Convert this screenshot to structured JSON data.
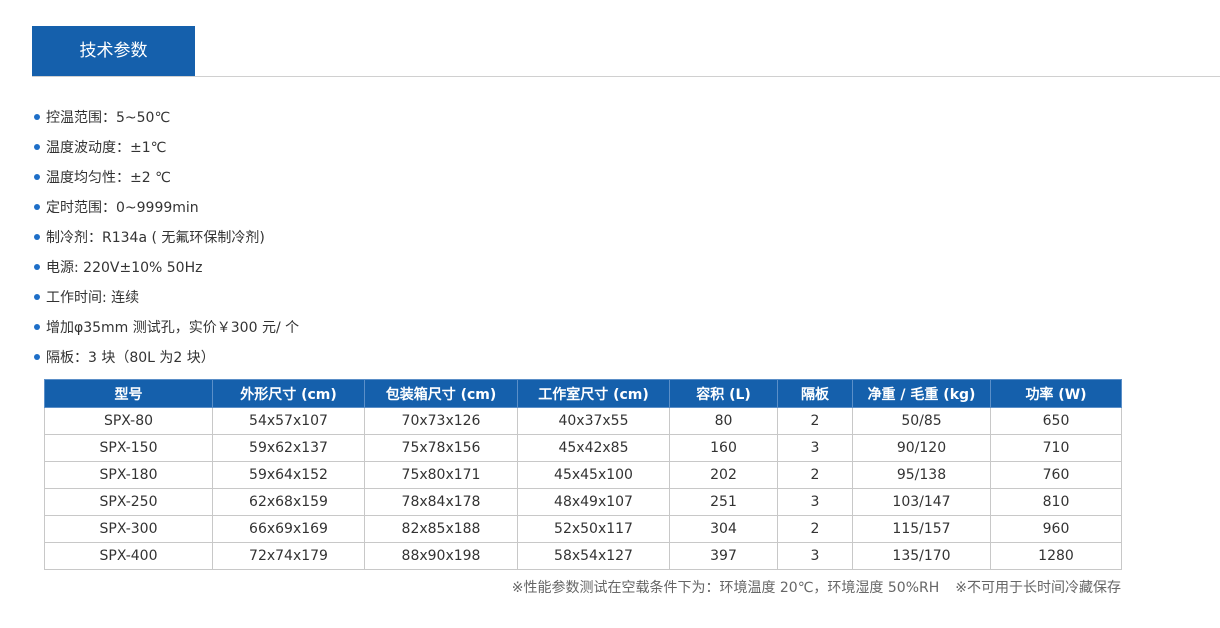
{
  "section": {
    "tab_label": "技术参数",
    "accent_color": "#1560ac",
    "bullet_color": "#1e6fc8"
  },
  "specs": [
    "控温范围：5~50℃",
    "温度波动度：±1℃",
    "温度均匀性：±2 ℃",
    "定时范围：0~9999min",
    "制冷剂：R134a ( 无氟环保制冷剂)",
    "电源: 220V±10% 50Hz",
    "工作时间: 连续",
    "增加φ35mm 测试孔，实价￥300 元/ 个",
    "隔板：3 块（80L 为2 块）"
  ],
  "table": {
    "headers": [
      "型号",
      "外形尺寸 (cm)",
      "包装箱尺寸 (cm)",
      "工作室尺寸 (cm)",
      "容积 (L)",
      "隔板",
      "净重 / 毛重 (kg)",
      "功率 (W)"
    ],
    "rows": [
      [
        "SPX-80",
        "54x57x107",
        "70x73x126",
        "40x37x55",
        "80",
        "2",
        "50/85",
        "650"
      ],
      [
        "SPX-150",
        "59x62x137",
        "75x78x156",
        "45x42x85",
        "160",
        "3",
        "90/120",
        "710"
      ],
      [
        "SPX-180",
        "59x64x152",
        "75x80x171",
        "45x45x100",
        "202",
        "2",
        "95/138",
        "760"
      ],
      [
        "SPX-250",
        "62x68x159",
        "78x84x178",
        "48x49x107",
        "251",
        "3",
        "103/147",
        "810"
      ],
      [
        "SPX-300",
        "66x69x169",
        "82x85x188",
        "52x50x117",
        "304",
        "2",
        "115/157",
        "960"
      ],
      [
        "SPX-400",
        "72x74x179",
        "88x90x198",
        "58x54x127",
        "397",
        "3",
        "135/170",
        "1280"
      ]
    ]
  },
  "notes": {
    "condition": "※性能参数测试在空载条件下为：环境温度 20℃，环境湿度 50%RH",
    "warning": "※不可用于长时间冷藏保存"
  }
}
